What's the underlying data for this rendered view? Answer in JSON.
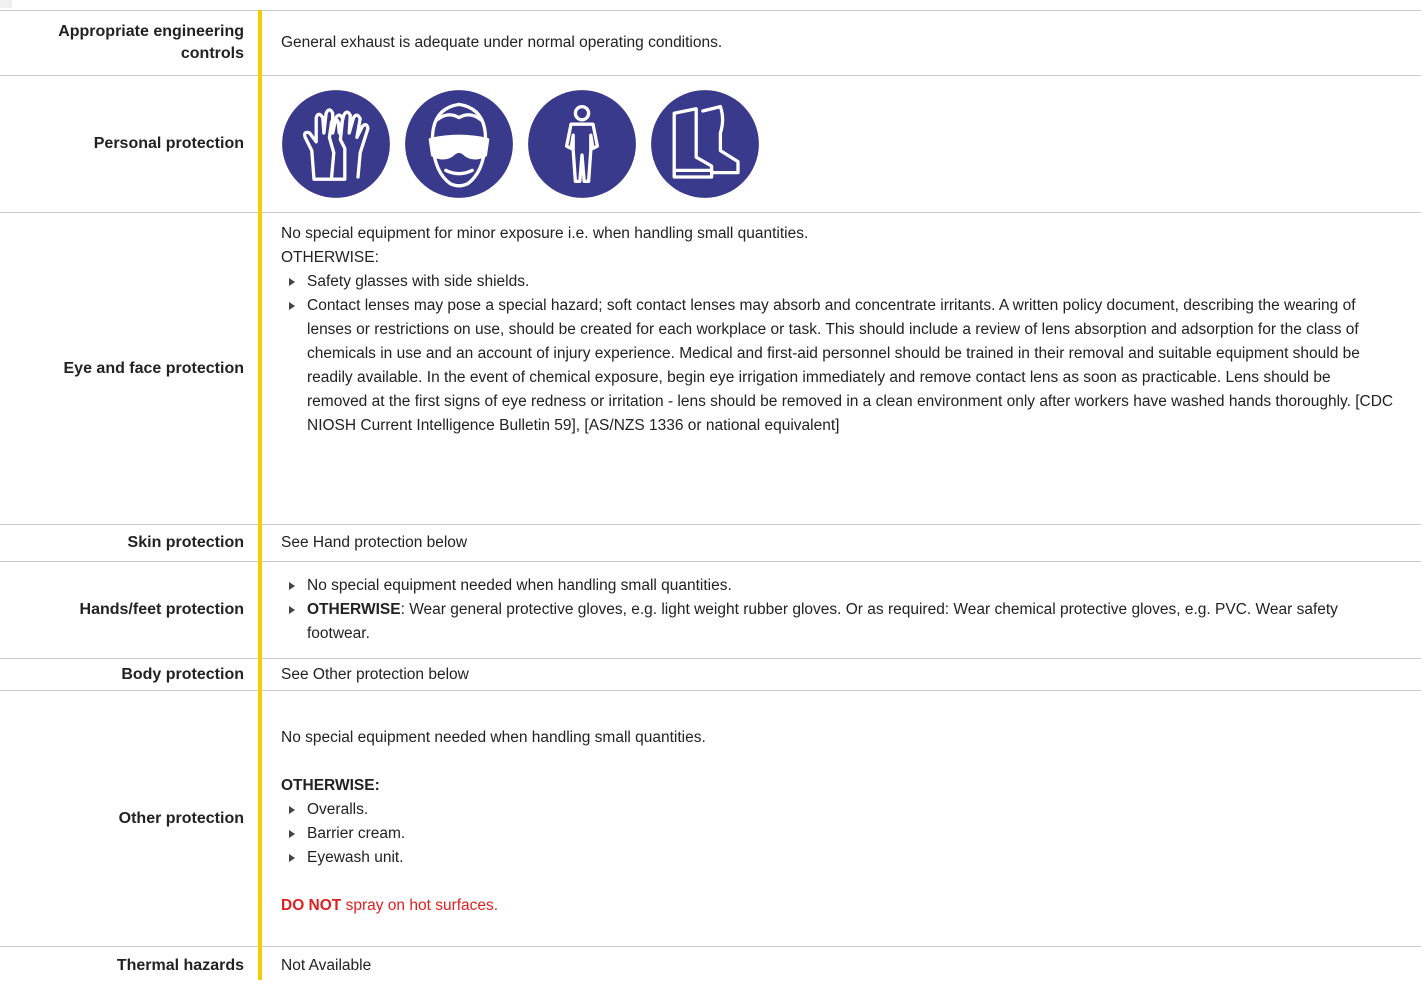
{
  "rows": {
    "engineering": {
      "label": "Appropriate engineering controls",
      "value": "General exhaust is adequate under normal operating conditions."
    },
    "personal": {
      "label": "Personal protection",
      "icons": [
        "gloves-icon",
        "goggles-icon",
        "overalls-icon",
        "boots-icon"
      ]
    },
    "eye_face": {
      "label": "Eye and face protection",
      "intro": "No special equipment for minor exposure i.e. when handling small quantities.",
      "otherwise": "OTHERWISE:",
      "bullets": [
        "Safety glasses with side shields.",
        "Contact lenses may pose a special hazard; soft contact lenses may absorb and concentrate irritants. A written policy document, describing the wearing of lenses or restrictions on use, should be created for each workplace or task. This should include a review of lens absorption and adsorption for the class of chemicals in use and an account of injury experience. Medical and first-aid personnel should be trained in their removal and suitable equipment should be readily available. In the event of chemical exposure, begin eye irrigation immediately and remove contact lens as soon as practicable. Lens should be removed at the first signs of eye redness or irritation - lens should be removed in a clean environment only after workers have washed hands thoroughly. [CDC NIOSH Current Intelligence Bulletin 59], [AS/NZS 1336 or national equivalent]"
      ]
    },
    "skin": {
      "label": "Skin protection",
      "value": "See Hand protection below"
    },
    "hands_feet": {
      "label": "Hands/feet protection",
      "bullet1": "No special equipment needed when handling small quantities.",
      "bullet2_bold": "OTHERWISE",
      "bullet2_rest": ": Wear general protective gloves, e.g. light weight rubber gloves. Or as required: Wear chemical protective gloves, e.g. PVC. Wear safety footwear."
    },
    "body": {
      "label": "Body protection",
      "value": "See Other protection below"
    },
    "other": {
      "label": "Other protection",
      "intro": "No special equipment needed when handling small quantities.",
      "otherwise": "OTHERWISE:",
      "bullets": [
        " Overalls.",
        "Barrier cream.",
        "Eyewash unit."
      ],
      "warning_bold": "DO NOT",
      "warning_rest": " spray on hot surfaces."
    },
    "thermal": {
      "label": "Thermal hazards",
      "value": "Not Available"
    }
  },
  "colors": {
    "accent_bar": "#f5cc00",
    "icon_circle": "#3a3a8c",
    "warning": "#e02020",
    "rule": "#c8c8c8"
  }
}
